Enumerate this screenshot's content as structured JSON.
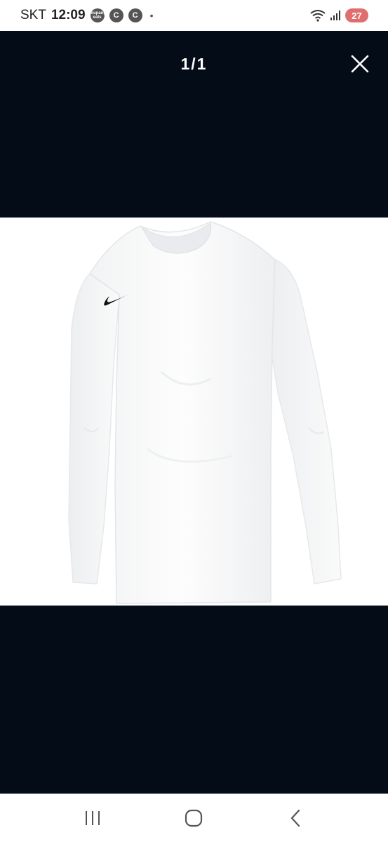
{
  "status_bar": {
    "carrier": "SKT",
    "time": "12:09",
    "notification_icons": [
      {
        "icon": "coupang-eats-icon",
        "text": "coupang eats"
      },
      {
        "icon": "c-badge-icon",
        "text": "C"
      },
      {
        "icon": "c-badge-icon",
        "text": "C"
      }
    ],
    "dot": "•",
    "battery_level": "27",
    "battery_color": "#e16e6e"
  },
  "viewer": {
    "counter": "1/1",
    "background_color": "#030c17",
    "close_icon": "close-icon"
  },
  "product_image": {
    "subject": "white long-sleeve shirt",
    "logo_icon": "swoosh-logo-icon"
  },
  "nav_bar": {
    "recents_icon": "recents-icon",
    "home_icon": "home-icon",
    "back_icon": "back-icon"
  }
}
